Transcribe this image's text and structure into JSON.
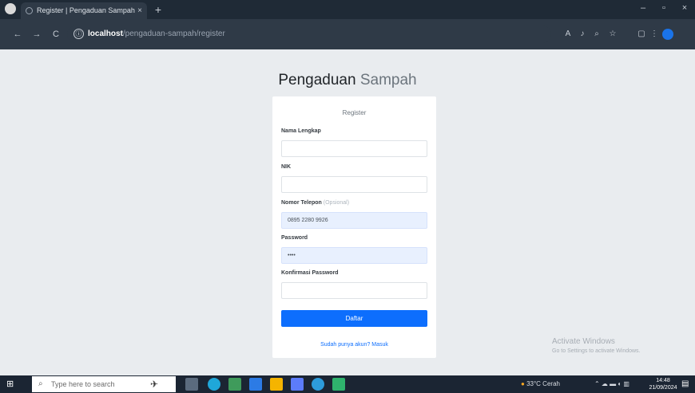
{
  "browser": {
    "tab_title": "Register | Pengaduan Sampah",
    "tab_close": "×",
    "new_tab": "+",
    "window_controls": {
      "minimize": "–",
      "maximize": "▫",
      "close": "×"
    },
    "nav": {
      "back": "←",
      "forward": "→",
      "reload": "C",
      "info": "ⓘ"
    },
    "url_host": "localhost",
    "url_path": "/pengaduan-sampah/register",
    "toolbar_icons": [
      "translate-icon",
      "read-aloud-icon",
      "zoom-icon",
      "star-icon",
      "extensions-icon",
      "menu-icon"
    ]
  },
  "page": {
    "title_part1": "Pengaduan",
    "title_part2": "Sampah"
  },
  "form": {
    "header": "Register",
    "fields": [
      {
        "label": "Nama Lengkap",
        "optional": "",
        "value": ""
      },
      {
        "label": "NIK",
        "optional": "",
        "value": ""
      },
      {
        "label": "Nomor Telepon",
        "optional": "(Opsional)",
        "value": "0895 2280 9926"
      },
      {
        "label": "Password",
        "optional": "",
        "value": "••••"
      },
      {
        "label": "Konfirmasi Password",
        "optional": "",
        "value": ""
      }
    ],
    "submit_label": "Daftar",
    "login_link": "Sudah punya akun? Masuk"
  },
  "watermark": {
    "line1": "Activate Windows",
    "line2": "Go to Settings to activate Windows."
  },
  "taskbar": {
    "search_placeholder": "Type here to search",
    "weather": "33°C Cerah",
    "clock_time": "14:48",
    "clock_date": "21/09/2024"
  },
  "colors": {
    "accent": "#0d6efd",
    "page_bg": "#e9ecef",
    "browser_chrome": "#2f3a47",
    "taskbar": "#1b2533"
  }
}
